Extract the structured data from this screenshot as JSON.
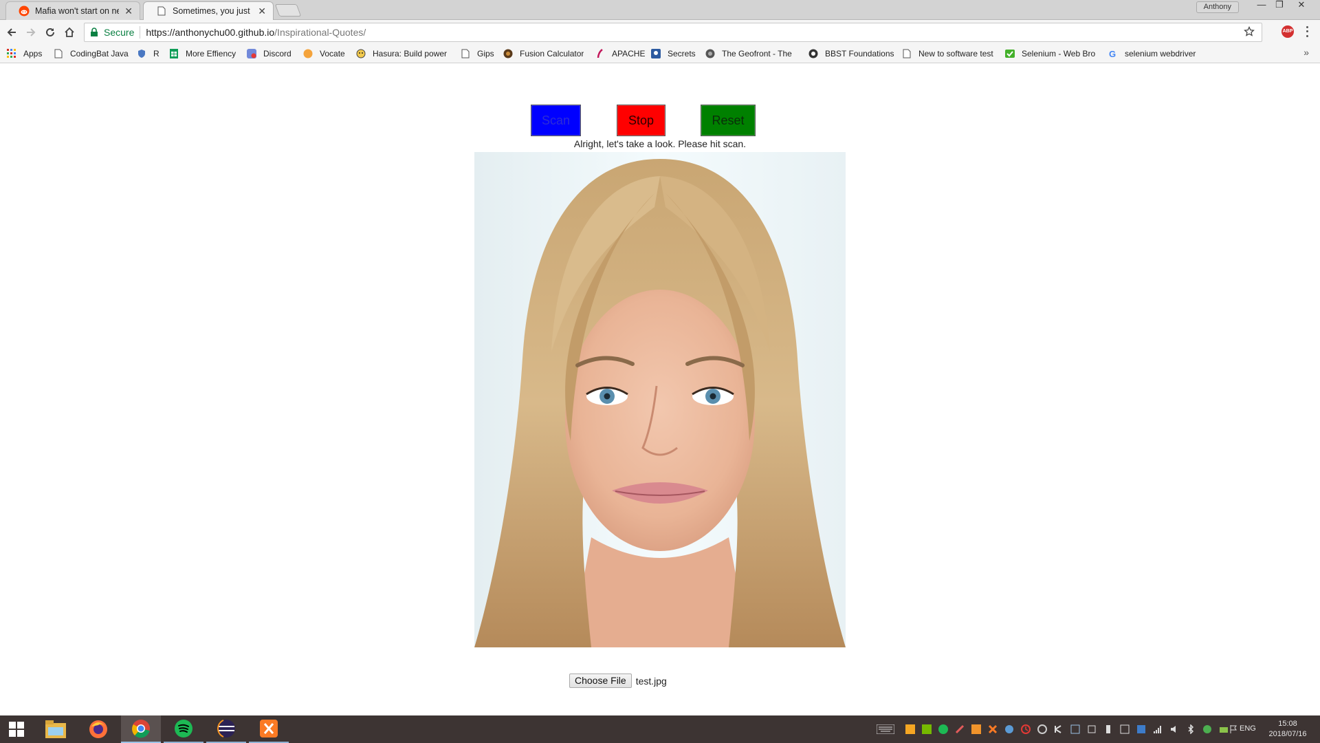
{
  "tabs": [
    {
      "title": "Mafia won't start on new",
      "favicon": "reddit-icon",
      "active": false
    },
    {
      "title": "Sometimes, you just need",
      "favicon": "page-icon",
      "active": true
    }
  ],
  "window": {
    "profile_name": "Anthony"
  },
  "address_bar": {
    "security_label": "Secure",
    "url_main": "https://anthonychu00.github.io",
    "url_path": "/Inspirational-Quotes/"
  },
  "bookmarks": [
    {
      "label": "Apps",
      "icon": "apps-grid-icon"
    },
    {
      "label": "CodingBat Java",
      "icon": "page-icon"
    },
    {
      "label": "R",
      "icon": "shield-icon"
    },
    {
      "label": "More Effiency",
      "icon": "sheets-icon"
    },
    {
      "label": "Discord",
      "icon": "discord-icon"
    },
    {
      "label": "Vocate",
      "icon": "vocate-icon"
    },
    {
      "label": "Hasura: Build power",
      "icon": "hasura-icon"
    },
    {
      "label": "Gips",
      "icon": "page-icon"
    },
    {
      "label": "Fusion Calculator",
      "icon": "fusion-icon"
    },
    {
      "label": "APACHE",
      "icon": "feather-icon"
    },
    {
      "label": "Secrets",
      "icon": "secrets-icon"
    },
    {
      "label": "The Geofront - The",
      "icon": "geofront-icon"
    },
    {
      "label": "BBST Foundations",
      "icon": "bbst-icon"
    },
    {
      "label": "New to software test",
      "icon": "page-icon"
    },
    {
      "label": "Selenium - Web Bro",
      "icon": "selenium-icon"
    },
    {
      "label": "selenium webdriver",
      "icon": "google-icon"
    }
  ],
  "page": {
    "buttons": {
      "scan": "Scan",
      "stop": "Stop",
      "reset": "Reset"
    },
    "status_text": "Alright, let's take a look. Please hit scan.",
    "file_button": "Choose File",
    "file_name": "test.jpg"
  },
  "taskbar": {
    "apps": [
      "file-explorer-icon",
      "firefox-icon",
      "chrome-icon",
      "spotify-icon",
      "eclipse-icon",
      "xampp-icon"
    ],
    "language": "ENG",
    "time": "15:08",
    "date": "2018/07/16"
  },
  "colors": {
    "scan": "#0000ff",
    "stop": "#ff0000",
    "reset": "#008000",
    "secure": "#0b8043"
  }
}
